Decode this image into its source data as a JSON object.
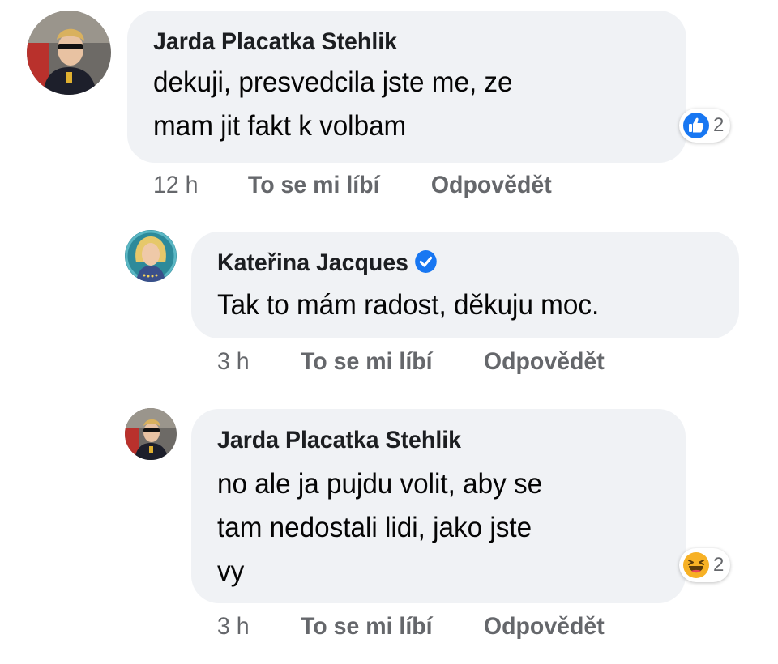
{
  "comments": [
    {
      "author": "Jarda Placatka Stehlik",
      "text": "dekuji, presvedcila jste me, ze\nmam jit fakt k volbam",
      "time": "12 h",
      "like_label": "To se mi líbí",
      "reply_label": "Odpovědět",
      "reaction": {
        "icon": "like-icon",
        "count": "2"
      }
    },
    {
      "author": "Kateřina Jacques",
      "verified": true,
      "text": "Tak to mám radost, děkuju moc.",
      "time": "3 h",
      "like_label": "To se mi líbí",
      "reply_label": "Odpovědět"
    },
    {
      "author": "Jarda Placatka Stehlik",
      "text": "no ale ja pujdu volit, aby se\ntam nedostali lidi, jako jste\nvy",
      "time": "3 h",
      "like_label": "To se mi líbí",
      "reply_label": "Odpovědět",
      "reaction": {
        "icon": "haha-icon",
        "count": "2"
      }
    }
  ],
  "colors": {
    "bubble": "#f0f2f5",
    "meta": "#65676b",
    "like_blue": "#1877f2",
    "verified_blue": "#1877f2",
    "haha_yellow": "#f7b125"
  }
}
